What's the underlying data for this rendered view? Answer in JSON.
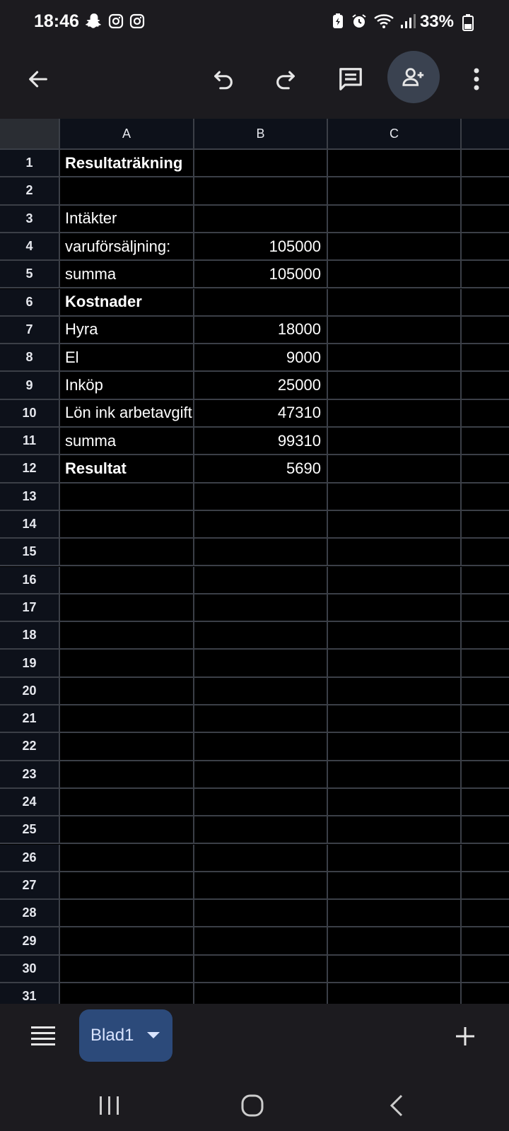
{
  "status_bar": {
    "time": "18:46",
    "battery_percent": "33%",
    "left_icons": [
      "snapchat-icon",
      "instagram-icon",
      "instagram-icon"
    ],
    "right_icons": [
      "battery-saver-icon",
      "alarm-icon",
      "wifi-icon",
      "signal-icon",
      "battery-icon"
    ]
  },
  "toolbar": {
    "icons": [
      "back-arrow-icon",
      "undo-icon",
      "redo-icon",
      "comment-icon",
      "share-person-add-icon",
      "more-vert-icon"
    ]
  },
  "grid": {
    "columns": [
      "A",
      "B",
      "C"
    ],
    "rows": [
      {
        "n": "1",
        "a": "Resultaträkning",
        "b": "",
        "bold": true
      },
      {
        "n": "2",
        "a": "",
        "b": "",
        "bold": false
      },
      {
        "n": "3",
        "a": "Intäkter",
        "b": "",
        "bold": false
      },
      {
        "n": "4",
        "a": "varuförsäljning:",
        "b": "105000",
        "bold": false
      },
      {
        "n": "5",
        "a": "summa",
        "b": "105000",
        "bold": false
      },
      {
        "n": "6",
        "a": "Kostnader",
        "b": "",
        "bold": true
      },
      {
        "n": "7",
        "a": "Hyra",
        "b": "18000",
        "bold": false
      },
      {
        "n": "8",
        "a": "El",
        "b": "9000",
        "bold": false
      },
      {
        "n": "9",
        "a": "Inköp",
        "b": "25000",
        "bold": false
      },
      {
        "n": "10",
        "a": "Lön ink arbetavgift",
        "b": "47310",
        "bold": false
      },
      {
        "n": "11",
        "a": "summa",
        "b": "99310",
        "bold": false
      },
      {
        "n": "12",
        "a": "Resultat",
        "b": "5690",
        "bold": true
      },
      {
        "n": "13",
        "a": "",
        "b": "",
        "bold": false
      },
      {
        "n": "14",
        "a": "",
        "b": "",
        "bold": false
      },
      {
        "n": "15",
        "a": "",
        "b": "",
        "bold": false
      },
      {
        "n": "16",
        "a": "",
        "b": "",
        "bold": false
      },
      {
        "n": "17",
        "a": "",
        "b": "",
        "bold": false
      },
      {
        "n": "18",
        "a": "",
        "b": "",
        "bold": false
      },
      {
        "n": "19",
        "a": "",
        "b": "",
        "bold": false
      },
      {
        "n": "20",
        "a": "",
        "b": "",
        "bold": false
      },
      {
        "n": "21",
        "a": "",
        "b": "",
        "bold": false
      },
      {
        "n": "22",
        "a": "",
        "b": "",
        "bold": false
      },
      {
        "n": "23",
        "a": "",
        "b": "",
        "bold": false
      },
      {
        "n": "24",
        "a": "",
        "b": "",
        "bold": false
      },
      {
        "n": "25",
        "a": "",
        "b": "",
        "bold": false
      },
      {
        "n": "26",
        "a": "",
        "b": "",
        "bold": false
      },
      {
        "n": "27",
        "a": "",
        "b": "",
        "bold": false
      },
      {
        "n": "28",
        "a": "",
        "b": "",
        "bold": false
      },
      {
        "n": "29",
        "a": "",
        "b": "",
        "bold": false
      },
      {
        "n": "30",
        "a": "",
        "b": "",
        "bold": false
      },
      {
        "n": "31",
        "a": "",
        "b": "",
        "bold": false
      }
    ]
  },
  "sheets": {
    "active_tab": "Blad1",
    "icons": [
      "sheet-list-icon",
      "dropdown-icon",
      "add-sheet-icon"
    ]
  },
  "nav_bar": {
    "icons": [
      "recents-icon",
      "home-icon",
      "back-icon"
    ]
  },
  "colors": {
    "toolbar_bg": "#1c1b1f",
    "header_bg": "#0d111a",
    "gridline": "#3b3f47",
    "sheet_tab_bg": "#2c4a7a",
    "share_button_bg": "#3a4250"
  }
}
